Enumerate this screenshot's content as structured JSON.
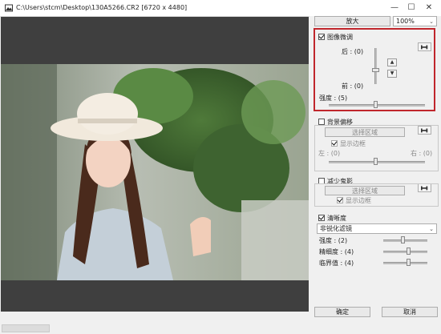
{
  "window": {
    "title": "C:\\Users\\stcm\\Desktop\\130A5266.CR2 [6720 x 4480]",
    "minimize": "—",
    "maximize": "☐",
    "close": "✕"
  },
  "toolbar": {
    "zoom_button": "放大",
    "zoom_value": "100%"
  },
  "sections": {
    "fine_tune": {
      "label": "图像微调",
      "checked": true,
      "top_label": "后 : (0)",
      "bottom_label": "前 : (0)",
      "strength_label": "强度 : (5)",
      "up_arrow": "▲",
      "down_arrow": "▼"
    },
    "bg_shift": {
      "label": "背景偏移",
      "checked": false,
      "select_area": "选择区域",
      "show_border": "显示边框",
      "show_border_checked": true,
      "left_label": "左 : (0)",
      "right_label": "右 : (0)"
    },
    "reduce_ghost": {
      "label": "减少鬼影",
      "checked": false,
      "select_area": "选择区域",
      "show_border": "显示边框",
      "show_border_checked": true
    },
    "sharpness": {
      "label": "清晰度",
      "checked": true,
      "filter": "非锐化滤镜",
      "strength_label": "强度 : (2)",
      "fineness_label": "精细度 : (4)",
      "threshold_label": "临界值 : (4)"
    }
  },
  "footer": {
    "ok": "确定",
    "cancel": "取消"
  },
  "icons": {
    "app": "image-app-icon",
    "eyedropper": "eyedropper-icon"
  },
  "colors": {
    "highlight": "#c0262c",
    "preview_bg": "#3f3f3f"
  }
}
